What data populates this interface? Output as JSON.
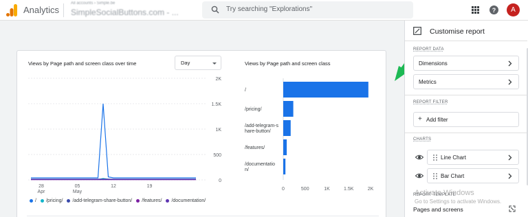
{
  "header": {
    "app_title": "Analytics",
    "account_crumb": "All accounts › Simple.be",
    "account_name": "SimpleSocialButtons.com - ...",
    "search_placeholder": "Try searching \"Explorations\"",
    "avatar_letter": "A",
    "icons": [
      "analytics-logo-icon",
      "search-icon",
      "apps-grid-icon",
      "help-icon"
    ]
  },
  "line_card": {
    "title": "Views by Page path and screen class over time",
    "granularity": "Day"
  },
  "bar_card": {
    "title": "Views by Page path and screen class"
  },
  "legend": [
    {
      "label": "/",
      "color": "#1a73e8"
    },
    {
      "label": "/pricing/",
      "color": "#12b5cb"
    },
    {
      "label": "/add-telegram-share-button/",
      "color": "#3949ab"
    },
    {
      "label": "/features/",
      "color": "#7b1fa2"
    },
    {
      "label": "/documentation/",
      "color": "#5e35b1"
    }
  ],
  "chart_data": [
    {
      "type": "line",
      "title": "Views by Page path and screen class over time",
      "x_tick_labels": [
        [
          "28",
          "Apr"
        ],
        [
          "05",
          "May"
        ],
        [
          "12",
          ""
        ],
        [
          "19",
          ""
        ]
      ],
      "y_tick_labels": [
        "2K",
        "1.5K",
        "1K",
        "500",
        "0"
      ],
      "ylim": [
        0,
        2000
      ],
      "series": [
        {
          "name": "/",
          "color": "#1a73e8",
          "values": [
            40,
            40,
            40,
            40,
            40,
            40,
            40,
            40,
            40,
            40,
            40,
            40,
            40,
            40,
            1500,
            60,
            40,
            40,
            40,
            40,
            40,
            40,
            40,
            40,
            40,
            40,
            40,
            40,
            40,
            40,
            40,
            40,
            40
          ]
        },
        {
          "name": "/pricing/",
          "color": "#12b5cb",
          "values": [
            10,
            10,
            10,
            10,
            10,
            10,
            10,
            10,
            10,
            10,
            10,
            10,
            10,
            10,
            30,
            15,
            10,
            10,
            10,
            10,
            10,
            10,
            10,
            10,
            10,
            10,
            10,
            10,
            10,
            10,
            10,
            10,
            10
          ]
        },
        {
          "name": "/add-telegram-share-button/",
          "color": "#3949ab",
          "values": [
            15,
            15,
            15,
            15,
            15,
            15,
            15,
            15,
            15,
            15,
            15,
            15,
            15,
            15,
            15,
            15,
            15,
            15,
            15,
            15,
            15,
            15,
            15,
            15,
            15,
            15,
            15,
            15,
            15,
            15,
            15,
            15,
            15
          ]
        },
        {
          "name": "/features/",
          "color": "#7b1fa2",
          "values": [
            5,
            5,
            5,
            5,
            5,
            5,
            5,
            5,
            5,
            5,
            5,
            5,
            5,
            5,
            5,
            5,
            5,
            5,
            5,
            5,
            5,
            5,
            5,
            5,
            5,
            5,
            5,
            5,
            5,
            5,
            5,
            5,
            5
          ]
        },
        {
          "name": "/documentation/",
          "color": "#5e35b1",
          "values": [
            8,
            8,
            8,
            8,
            8,
            8,
            8,
            8,
            8,
            8,
            8,
            8,
            8,
            8,
            8,
            8,
            8,
            8,
            8,
            8,
            8,
            8,
            8,
            8,
            8,
            8,
            8,
            8,
            8,
            8,
            8,
            8,
            8
          ]
        }
      ]
    },
    {
      "type": "bar",
      "orientation": "horizontal",
      "title": "Views by Page path and screen class",
      "categories": [
        [
          "/"
        ],
        [
          "/pricing/"
        ],
        [
          "/add-telegram-s",
          "hare-button/"
        ],
        [
          "/features/"
        ],
        [
          "/documentatio",
          "n/"
        ]
      ],
      "values": [
        1950,
        230,
        170,
        80,
        50
      ],
      "x_tick_labels": [
        "0",
        "500",
        "1K",
        "1.5K",
        "2K"
      ],
      "xlim": [
        0,
        2000
      ],
      "color": "#1a73e8"
    }
  ],
  "panel": {
    "title": "Customise report",
    "report_data_label": "REPORT DATA",
    "dimensions_label": "Dimensions",
    "metrics_label": "Metrics",
    "report_filter_label": "REPORT FILTER",
    "add_filter_label": "Add filter",
    "charts_label": "CHARTS",
    "line_chart_label": "Line Chart",
    "bar_chart_label": "Bar Chart",
    "report_template_label": "REPORT TEMPLATE",
    "template_value": "Pages and screens",
    "watermark_title": "Activate Windows",
    "watermark_sub": "Go to Settings to activate Windows."
  },
  "annotation_arrow_color": "#1db954"
}
